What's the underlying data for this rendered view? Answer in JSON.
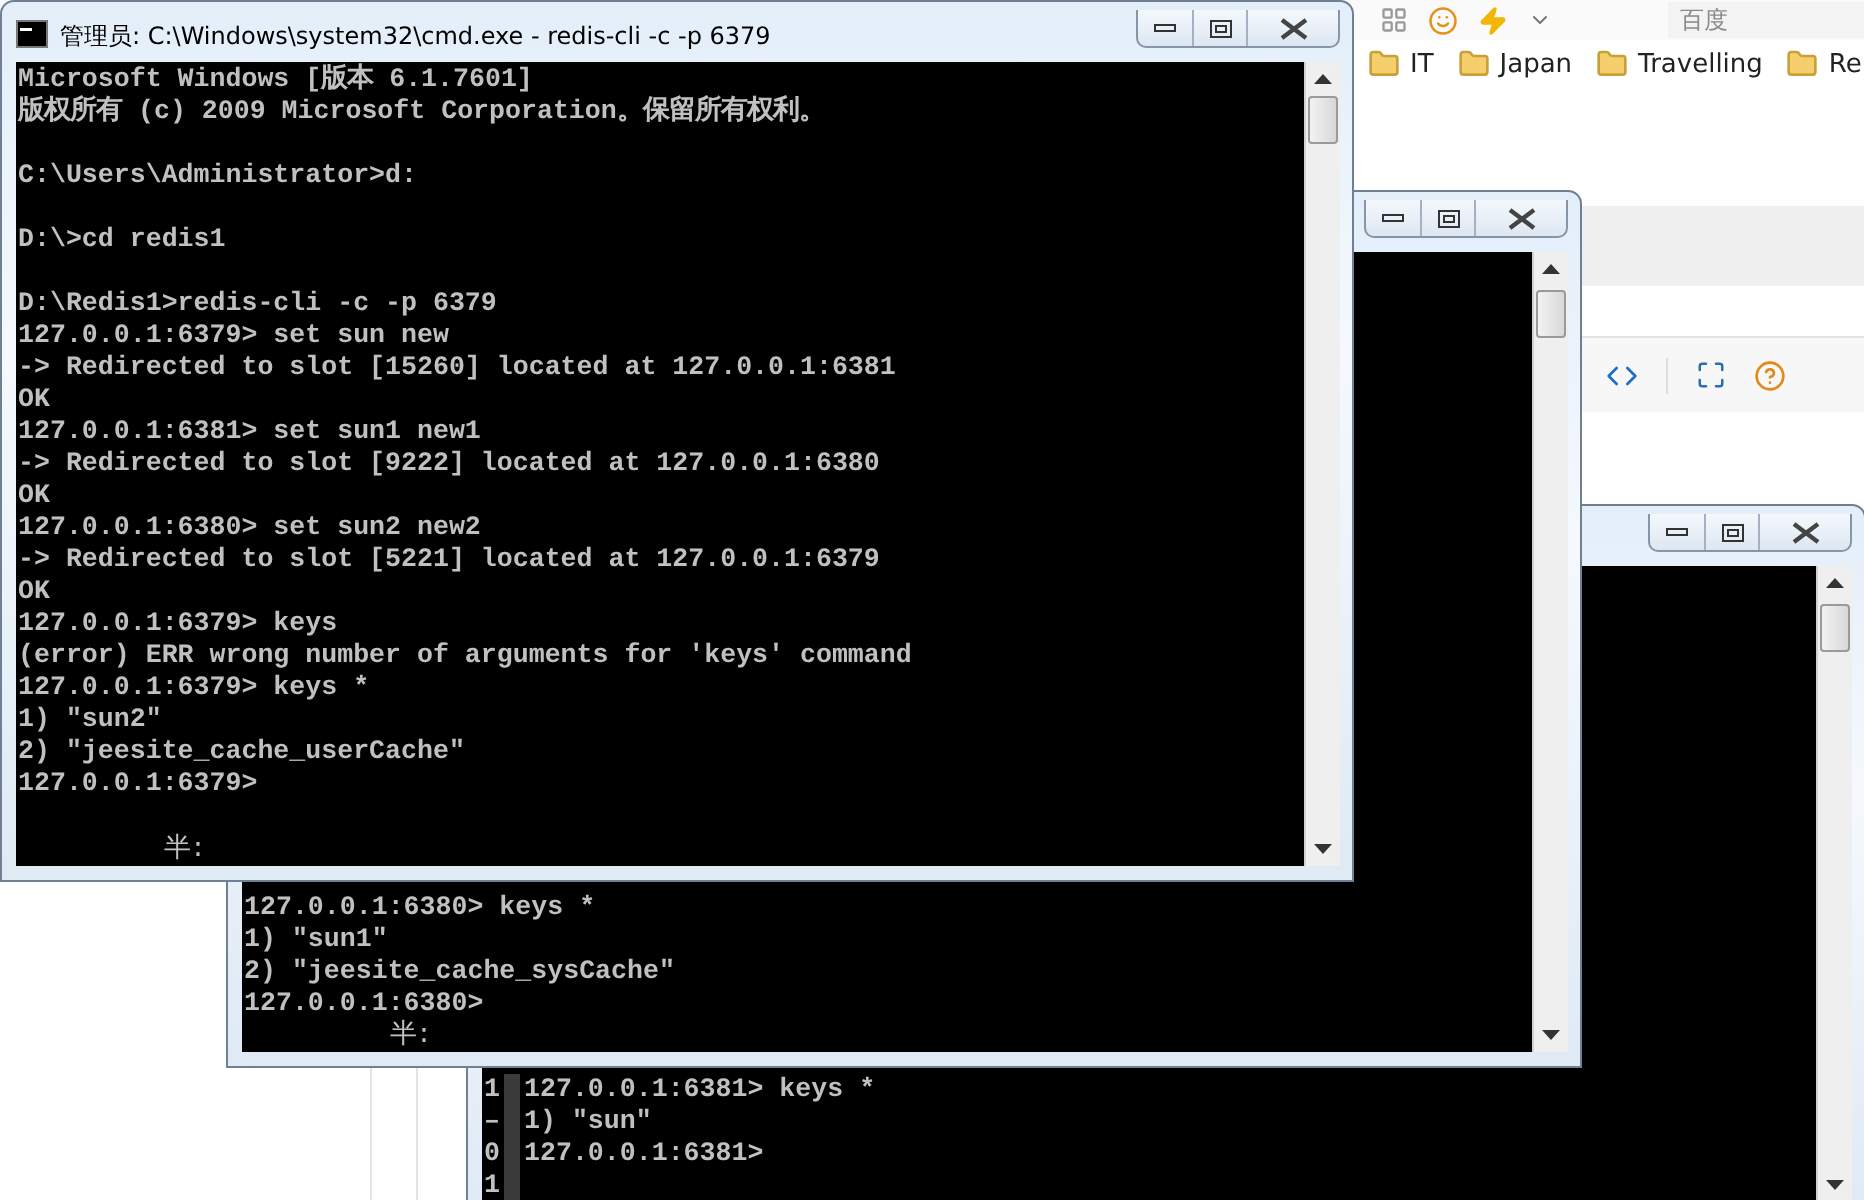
{
  "browser": {
    "search": {
      "placeholder": "百度"
    },
    "bookmarks": [
      {
        "label": "IT"
      },
      {
        "label": "Japan"
      },
      {
        "label": "Travelling"
      },
      {
        "label": "Re"
      }
    ]
  },
  "windows": [
    {
      "title": "管理员: C:\\Windows\\system32\\cmd.exe - redis-cli  -c -p 6379",
      "blocks": [
        [
          "Microsoft Windows [版本 6.1.7601]",
          "版权所有 (c) 2009 Microsoft Corporation。保留所有权利。"
        ],
        [
          "C:\\Users\\Administrator>d:"
        ],
        [
          "D:\\>cd redis1"
        ],
        [
          "D:\\Redis1>redis-cli -c -p 6379",
          "127.0.0.1:6379> set sun new",
          "-> Redirected to slot [15260] located at 127.0.0.1:6381",
          "OK",
          "127.0.0.1:6381> set sun1 new1",
          "-> Redirected to slot [9222] located at 127.0.0.1:6380",
          "OK",
          "127.0.0.1:6380> set sun2 new2",
          "-> Redirected to slot [5221] located at 127.0.0.1:6379",
          "OK",
          "127.0.0.1:6379> keys",
          "(error) ERR wrong number of arguments for 'keys' command",
          "127.0.0.1:6379> keys *",
          "1) \"sun2\"",
          "2) \"jeesite_cache_userCache\"",
          "127.0.0.1:6379>"
        ]
      ],
      "ime": "半:"
    },
    {
      "blocks": [
        [
          "127.0.0.1:6380> keys *",
          "1) \"sun1\"",
          "2) \"jeesite_cache_sysCache\"",
          "127.0.0.1:6380>"
        ]
      ],
      "ime": "半:"
    },
    {
      "blocks": [
        [
          "127.0.0.1:6381> keys *",
          "1) \"sun\"",
          "127.0.0.1:6381>"
        ]
      ],
      "gutter": [
        "1",
        "–",
        "0",
        "1"
      ]
    }
  ]
}
